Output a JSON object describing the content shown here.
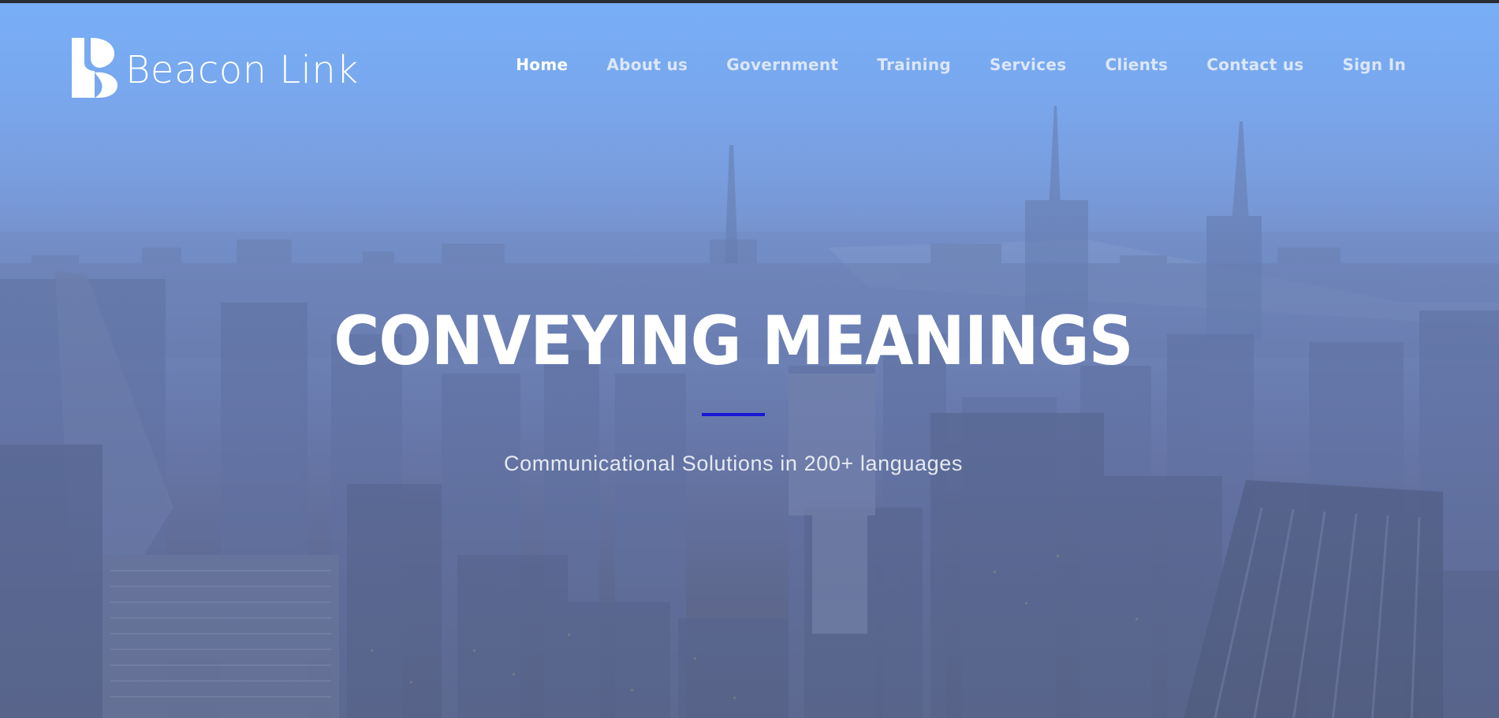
{
  "brand": {
    "name": "Beacon Link",
    "logo_icon": "beacon-link-logo-mark",
    "text_color": "#ffffff"
  },
  "nav": {
    "items": [
      {
        "label": "Home",
        "active": true
      },
      {
        "label": "About us",
        "active": false
      },
      {
        "label": "Government",
        "active": false
      },
      {
        "label": "Training",
        "active": false
      },
      {
        "label": "Services",
        "active": false
      },
      {
        "label": "Clients",
        "active": false
      },
      {
        "label": "Contact us",
        "active": false
      },
      {
        "label": "Sign In",
        "active": false
      }
    ]
  },
  "hero": {
    "title": "CONVEYING MEANINGS",
    "subtitle": "Communicational Solutions in 200+ languages",
    "background": "city-skyline-aerial-image",
    "divider_color": "#1717d6",
    "sky_color": "#77aff6"
  }
}
